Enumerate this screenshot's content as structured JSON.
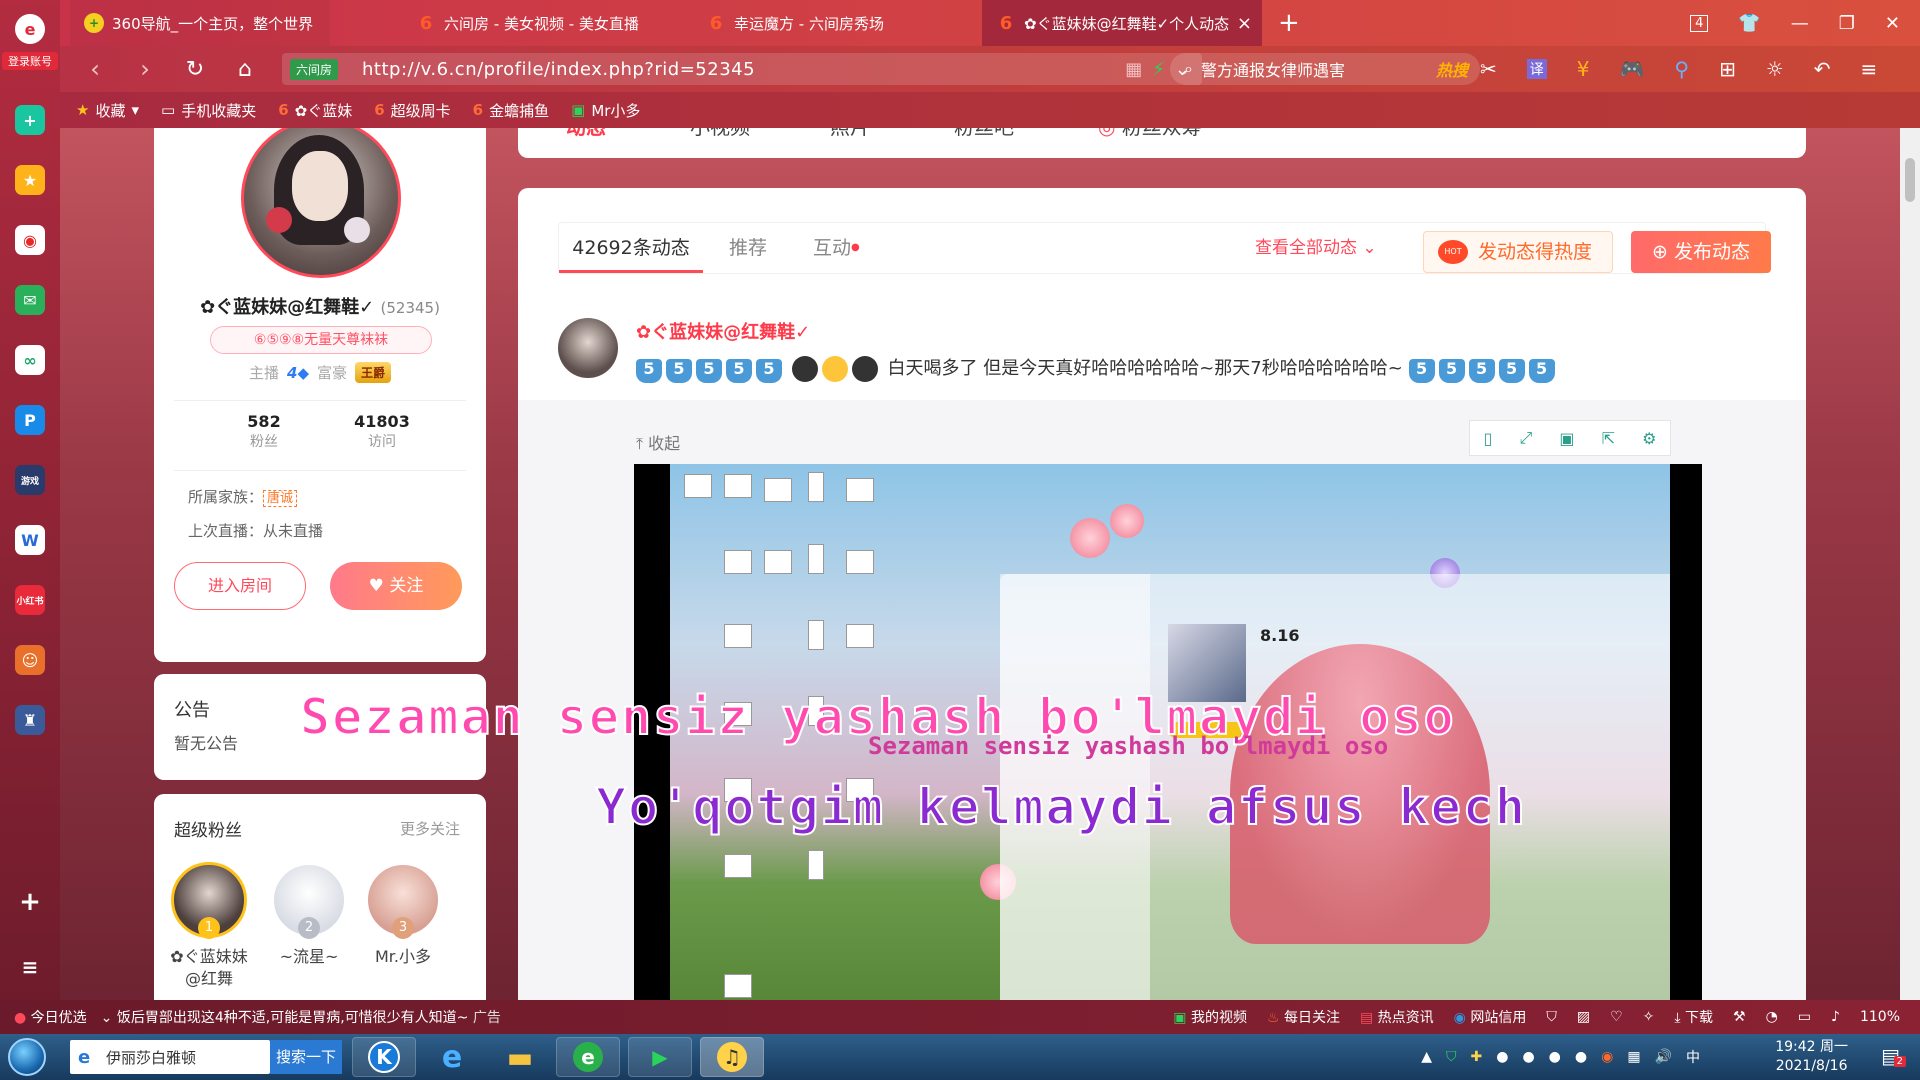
{
  "browser": {
    "tabs": [
      {
        "label": "360导航_一个主页，整个世界"
      },
      {
        "label": "六间房 - 美女视频 - 美女直播"
      },
      {
        "label": "幸运魔方 - 六间房秀场"
      },
      {
        "label": "✿ぐ蓝妹妹@红舞鞋✓个人动态"
      }
    ],
    "tab_count": "4",
    "url": "http://v.6.cn/profile/index.php?rid=52345",
    "site_badge": "六间房",
    "search_text": "警方通报女律师遇害",
    "search_hot": "热搜",
    "login_label": "登录账号",
    "bookmarks": [
      "收藏",
      "手机收藏夹",
      "✿ぐ蓝妹",
      "超级周卡",
      "金蟾捕鱼",
      "Mr小多"
    ]
  },
  "nav_tabs": [
    "动态",
    "小视频",
    "照片",
    "粉丝吧",
    "粉丝众筹"
  ],
  "profile": {
    "nickname": "✿ぐ蓝妹妹@红舞鞋✓",
    "rid": "(52345)",
    "fan_group": "⑥⑤⑨⑧无量天尊袜袜",
    "anchor_label": "主播",
    "anchor_level": "4",
    "rich_label": "富豪",
    "rich_badge": "王爵",
    "fans_count": "582",
    "fans_label": "粉丝",
    "visits_count": "41803",
    "visits_label": "访问",
    "family_label": "所属家族：",
    "family_tag": "唐诚",
    "last_live": "上次直播：从未直播",
    "enter_room": "进入房间",
    "follow": "关注"
  },
  "notice": {
    "title": "公告",
    "body": "暂无公告"
  },
  "superfans": {
    "title": "超级粉丝",
    "more": "更多关注",
    "fans": [
      {
        "rank": "1",
        "name": "✿ぐ蓝妹妹@红舞"
      },
      {
        "rank": "2",
        "name": "~流星~"
      },
      {
        "rank": "3",
        "name": "Mr.小多"
      }
    ]
  },
  "feed": {
    "tabs": [
      "42692条动态",
      "推荐",
      "互动"
    ],
    "view_all": "查看全部动态",
    "heat_button": "发动态得热度",
    "publish_button": "发布动态",
    "post_author": "✿ぐ蓝妹妹@红舞鞋✓",
    "post_text": "白天喝多了 但是今天真好哈哈哈哈哈哈~那天7秒哈哈哈哈哈哈~",
    "collapse": "收起"
  },
  "media": {
    "music_title": "8.16",
    "lyric_line1": "Sezaman sensiz yashash bo'lmaydi oso",
    "lyric_line1_small": "Sezaman sensiz yashash bo'lmaydi oso",
    "lyric_line2": "Yo'qotgim kelmaydi afsus kech"
  },
  "statusbar": {
    "today": "今日优选",
    "news": "饭后胃部出现这4种不适,可能是胃病,可惜很少有人知道~",
    "ad": "广告",
    "items": [
      "我的视频",
      "每日关注",
      "热点资讯",
      "网站信用"
    ],
    "download": "下载",
    "zoom": "110%"
  },
  "taskbar": {
    "search_text": "伊丽莎白雅顿",
    "search_button": "搜索一下",
    "time": "19:42 周一",
    "date": "2021/8/16",
    "notify_count": "2"
  }
}
